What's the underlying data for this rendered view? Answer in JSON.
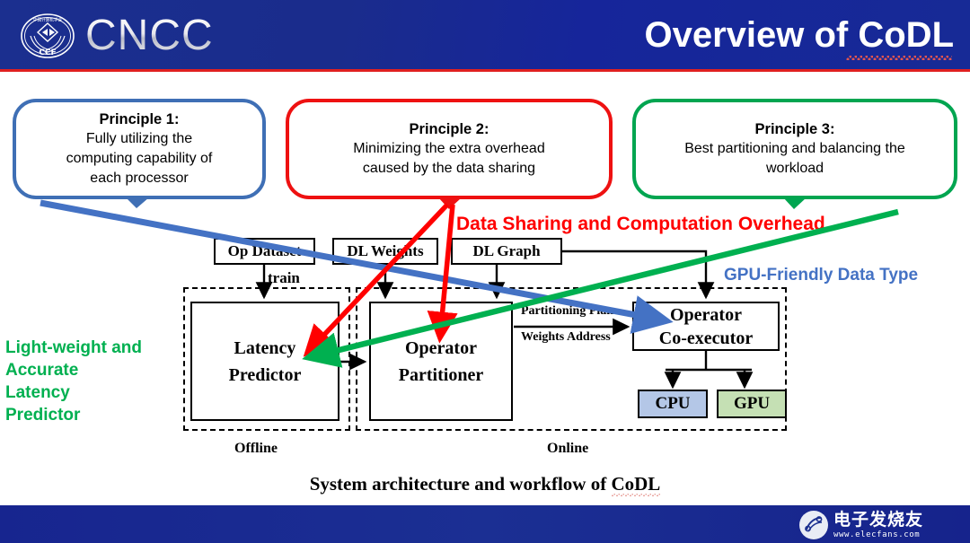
{
  "header": {
    "brand": "CNCC",
    "logo_name": "ccf-logo",
    "title": "Overview of CoDL"
  },
  "footer": {
    "watermark_cn": "电子发烧友",
    "watermark_url": "www.elecfans.com"
  },
  "principles": [
    {
      "id": "principle-1",
      "heading": "Principle 1:",
      "lines": [
        "Fully utilizing the",
        "computing capability of",
        "each processor"
      ],
      "color": "#3f6fb5"
    },
    {
      "id": "principle-2",
      "heading": "Principle 2:",
      "lines": [
        "Minimizing the extra overhead",
        "caused by the data sharing"
      ],
      "color": "#ee1111"
    },
    {
      "id": "principle-3",
      "heading": "Principle 3:",
      "lines": [
        "Best partitioning and balancing the",
        "workload"
      ],
      "color": "#00a550"
    }
  ],
  "annotations": {
    "data_sharing": "Data Sharing and Computation Overhead",
    "data_sharing_color": "#ff0000",
    "gpu_friendly": "GPU-Friendly Data Type",
    "gpu_friendly_color": "#4472c4",
    "latency_predictor_note": "Light-weight and\nAccurate\nLatency\nPredictor",
    "latency_predictor_note_lines": [
      "Light-weight and",
      "Accurate",
      "Latency",
      "Predictor"
    ],
    "latency_predictor_note_color": "#00b050"
  },
  "diagram": {
    "inputs": [
      {
        "id": "op-dataset",
        "label": "Op Dataset"
      },
      {
        "id": "dl-weights",
        "label": "DL Weights"
      },
      {
        "id": "dl-graph",
        "label": "DL Graph"
      }
    ],
    "edge_labels": {
      "train": "train",
      "partitioning_plan": "Partitioning Plan",
      "weights_address": "Weights Address"
    },
    "modules": [
      {
        "id": "latency-predictor",
        "line1": "Latency",
        "line2": "Predictor"
      },
      {
        "id": "operator-partitioner",
        "line1": "Operator",
        "line2": "Partitioner"
      },
      {
        "id": "operator-coexecutor",
        "line1": "Operator",
        "line2": "Co-executor"
      }
    ],
    "processors": [
      {
        "id": "cpu",
        "label": "CPU",
        "fill": "#b4c7e7"
      },
      {
        "id": "gpu",
        "label": "GPU",
        "fill": "#c5e0b4"
      }
    ],
    "phases": {
      "offline": "Offline",
      "online": "Online"
    },
    "caption_prefix": "System architecture and workflow of ",
    "caption_highlight": "CoDL"
  }
}
